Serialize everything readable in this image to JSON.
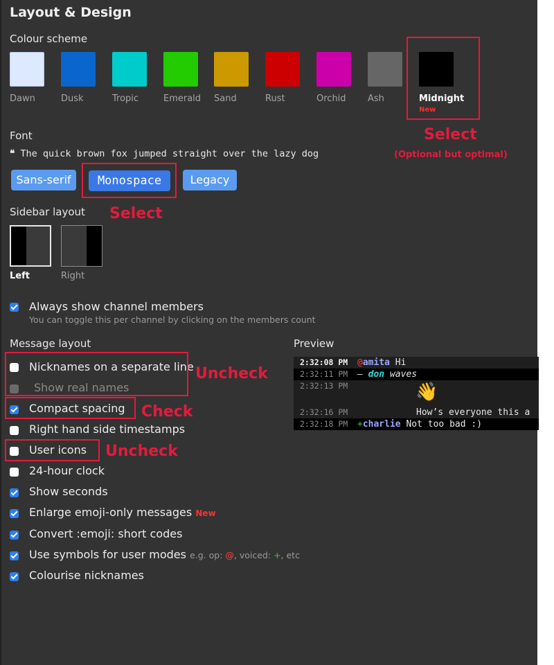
{
  "title": "Layout & Design",
  "colour_scheme": {
    "label": "Colour scheme",
    "schemes": [
      {
        "name": "Dawn",
        "color": "#dce9ff"
      },
      {
        "name": "Dusk",
        "color": "#0a66cc"
      },
      {
        "name": "Tropic",
        "color": "#00cccc"
      },
      {
        "name": "Emerald",
        "color": "#22cc00"
      },
      {
        "name": "Sand",
        "color": "#cc9900"
      },
      {
        "name": "Rust",
        "color": "#cc0000"
      },
      {
        "name": "Orchid",
        "color": "#cc00aa"
      },
      {
        "name": "Ash",
        "color": "#666666"
      },
      {
        "name": "Midnight",
        "color": "#000000",
        "badge": "New",
        "selected": true
      }
    ],
    "annotation": "Select",
    "annotation_sub": "(Optional but optimal)"
  },
  "font": {
    "label": "Font",
    "sample_quote": "❝",
    "sample": "The quick brown fox jumped straight over the lazy dog",
    "options": [
      "Sans-serif",
      "Monospace",
      "Legacy"
    ],
    "selected": "Monospace"
  },
  "sidebar": {
    "label": "Sidebar layout",
    "annotation": "Select",
    "options": [
      {
        "name": "Left",
        "selected": true
      },
      {
        "name": "Right",
        "selected": false
      }
    ]
  },
  "members": {
    "label": "Always show channel members",
    "hint": "You can toggle this per channel by clicking on the members count",
    "checked": true
  },
  "message_layout": {
    "label": "Message layout",
    "options": [
      {
        "label": "Nicknames on a separate line",
        "checked": false,
        "annotation": "Uncheck"
      },
      {
        "label": "Show real names",
        "checked": false,
        "disabled": true
      },
      {
        "label": "Compact spacing",
        "checked": true,
        "annotation": "Check"
      },
      {
        "label": "Right hand side timestamps",
        "checked": false
      },
      {
        "label": "User icons",
        "checked": false,
        "annotation": "Uncheck"
      },
      {
        "label": "24-hour clock",
        "checked": false
      },
      {
        "label": "Show seconds",
        "checked": true
      },
      {
        "label": "Enlarge emoji-only messages",
        "checked": true,
        "badge": "New"
      },
      {
        "label": "Convert :emoji: short codes",
        "checked": true
      },
      {
        "label": "Use symbols for user modes",
        "checked": true,
        "hint_prefix": "e.g. op:",
        "op_symbol": "@",
        "hint_mid": ", voiced:",
        "voice_symbol": "+",
        "hint_suffix": ", etc"
      },
      {
        "label": "Colourise nicknames",
        "checked": true
      }
    ]
  },
  "preview": {
    "label": "Preview",
    "lines": [
      {
        "time": "2:32:08 PM",
        "mode": "@",
        "nick": "amita",
        "text": " Hi"
      },
      {
        "time": "2:32:11 PM",
        "action_prefix": "— ",
        "nick": "don",
        "text": " waves"
      },
      {
        "time": "2:32:13 PM",
        "emoji": "👋"
      },
      {
        "time": "2:32:16 PM",
        "text": "How’s everyone this a"
      },
      {
        "time": "2:32:18 PM",
        "mode": "+",
        "nick": "charlie",
        "text": " Not too bad :)"
      }
    ]
  }
}
